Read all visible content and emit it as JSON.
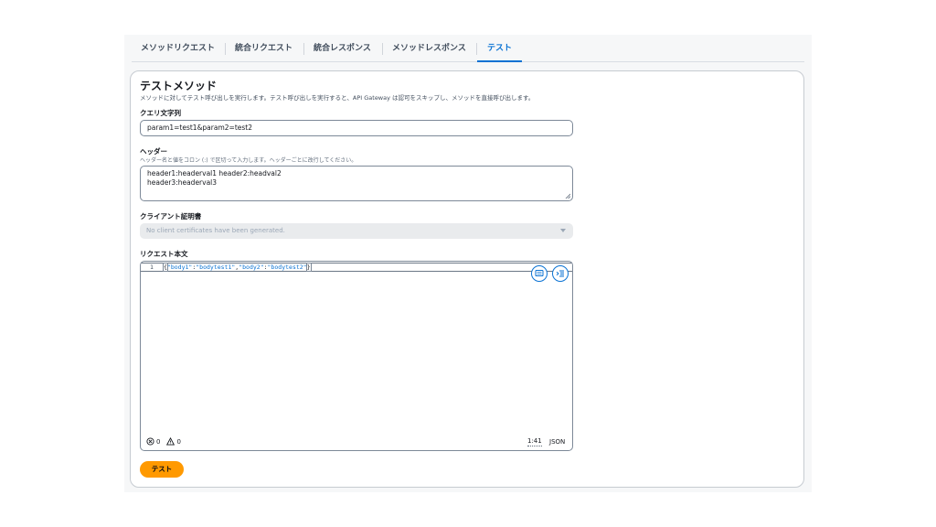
{
  "tabs": [
    {
      "label": "メソッドリクエスト",
      "active": false
    },
    {
      "label": "統合リクエスト",
      "active": false
    },
    {
      "label": "統合レスポンス",
      "active": false
    },
    {
      "label": "メソッドレスポンス",
      "active": false
    },
    {
      "label": "テスト",
      "active": true
    }
  ],
  "panel": {
    "title": "テストメソッド",
    "description": "メソッドに対してテスト呼び出しを実行します。テスト呼び出しを実行すると、API Gateway は認可をスキップし、メソッドを直接呼び出します。"
  },
  "query": {
    "label": "クエリ文字列",
    "value": "param1=test1&param2=test2"
  },
  "headers": {
    "label": "ヘッダー",
    "hint": "ヘッダー名と値をコロン (:) で区切って入力します。ヘッダーごとに改行してください。",
    "lines": [
      "header1:headerval1 header2:headval2",
      "header3:headerval3"
    ]
  },
  "client_cert": {
    "label": "クライアント証明書",
    "placeholder": "No client certificates have been generated."
  },
  "body": {
    "label": "リクエスト本文",
    "line_number": "1",
    "code_open": "{",
    "k1": "\"body1\"",
    "colon": ":",
    "v1": "\"bodytest1\"",
    "comma": ",",
    "k2": "\"body2\"",
    "v2": "\"bodytest2\"",
    "code_close": "}",
    "errors": "0",
    "warnings": "0",
    "cursor": "1:41",
    "language": "JSON"
  },
  "actions": {
    "test_label": "テスト"
  },
  "colors": {
    "accent": "#0972d3",
    "primary_button": "#ff9900"
  },
  "icons": [
    "format-icon",
    "indent-icon",
    "error-icon",
    "warning-icon",
    "caret-down-icon",
    "resize-handle-icon"
  ]
}
